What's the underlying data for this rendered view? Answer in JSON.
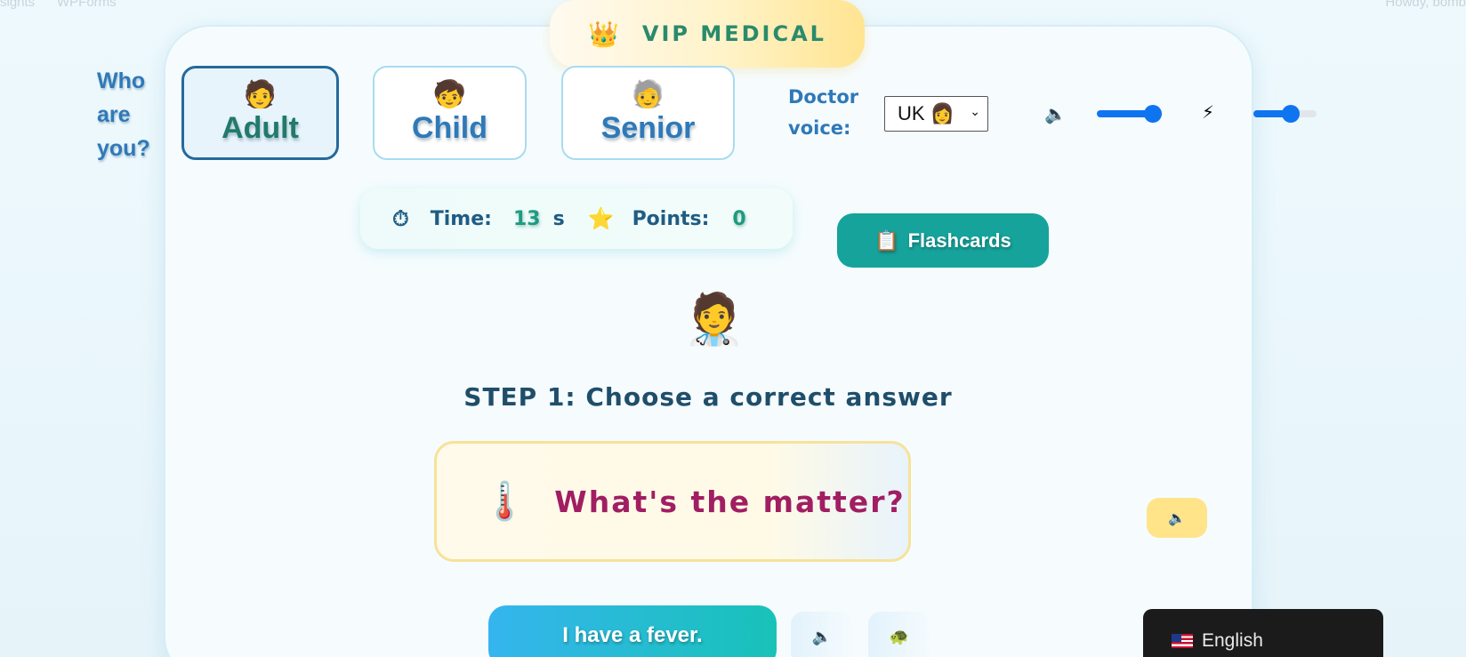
{
  "ghost_nav": {
    "left1": "sights",
    "left2": "WPForms",
    "right": "Howdy, bomb"
  },
  "banner": {
    "icon": "crown-icon",
    "title": "VIP MEDICAL"
  },
  "persona": {
    "prompt": "Who are you?",
    "options": [
      {
        "label": "Adult",
        "icon": "adult-face-icon",
        "face": "🧑",
        "active": true
      },
      {
        "label": "Child",
        "icon": "child-face-icon",
        "face": "🧒",
        "active": false
      },
      {
        "label": "Senior",
        "icon": "senior-face-icon",
        "face": "🧓",
        "active": false
      }
    ]
  },
  "voice": {
    "label": "Doctor voice:",
    "selected": "UK 👩"
  },
  "sliders": {
    "volume_level": 0.85,
    "speed_level": 0.59
  },
  "stats": {
    "time_label": "Time:",
    "time_value": "13",
    "time_unit": "s",
    "points_label": "Points:",
    "points_value": "0"
  },
  "flashcards": {
    "icon": "📋",
    "label": "Flashcards"
  },
  "step": "STEP 1: Choose a correct answer",
  "question": {
    "icon": "thermometer-icon",
    "text": "What's the matter?"
  },
  "answer": {
    "label": "I have a fever."
  },
  "language": {
    "label": "English"
  },
  "colors": {
    "accent_teal": "#16a39b",
    "question_text": "#a11e63",
    "persona_blue": "#2f79b8",
    "slider_blue": "#0f74f0"
  }
}
